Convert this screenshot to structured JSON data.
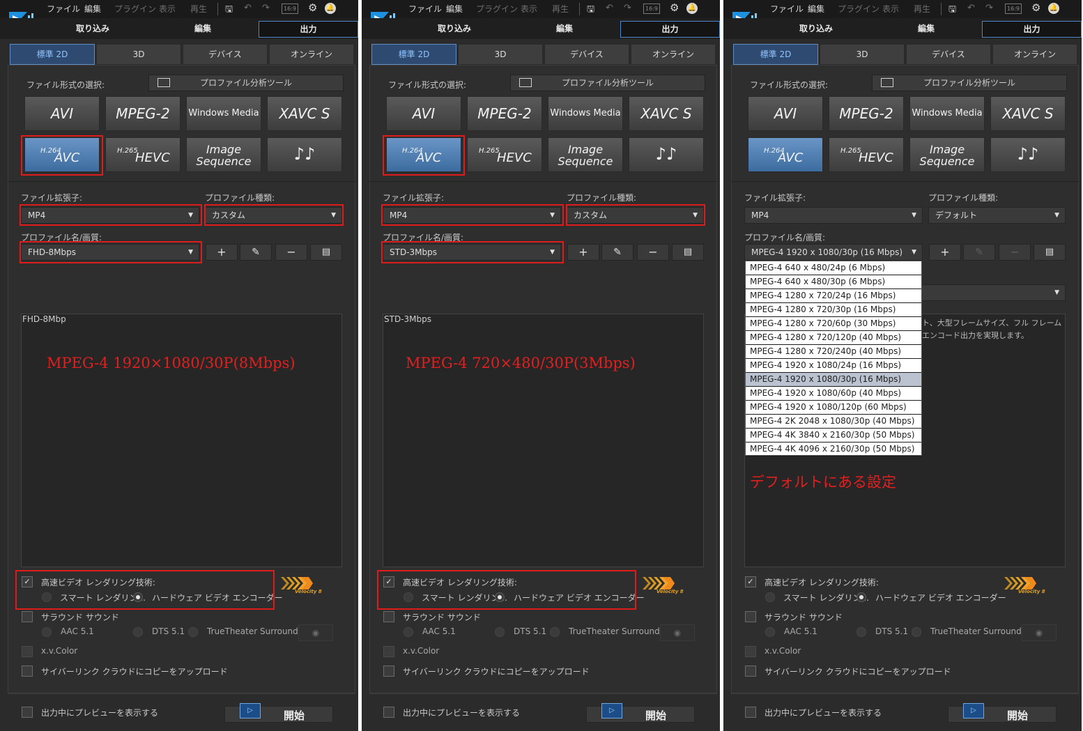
{
  "menu": {
    "file": "ファイル",
    "edit": "編集",
    "plugins": "プラグイン",
    "view": "表示",
    "playback": "再生"
  },
  "toolbar": {
    "aspect": "16:9"
  },
  "main_tabs": {
    "capture": "取り込み",
    "edit": "編集",
    "produce": "出力"
  },
  "sub_tabs": {
    "standard2d": "標準 2D",
    "threed": "3D",
    "device": "デバイス",
    "online": "オンライン"
  },
  "format_section": {
    "label": "ファイル形式の選択:",
    "analyzer": "プロファイル分析ツール"
  },
  "formats": {
    "avi": "AVI",
    "mpeg2": "MPEG-2",
    "wmv": "Windows Media",
    "xavc": "XAVC S",
    "h264_sup": "H.264",
    "avc": "AVC",
    "h265_sup": "H.265",
    "hevc": "HEVC",
    "image_seq_1": "Image",
    "image_seq_2": "Sequence",
    "audio": "♪♪"
  },
  "labels": {
    "extension": "ファイル拡張子:",
    "profile_type": "プロファイル種類:",
    "profile_name": "プロファイル名/画質:"
  },
  "buttons": {
    "add": "+",
    "edit": "✎",
    "remove": "−",
    "details": "▤"
  },
  "options": {
    "fast_render": "高速ビデオ レンダリング技術:",
    "smart_render": "スマート レンダリン...",
    "hw_encoder": "ハードウェア ビデオ エンコーダー",
    "surround": "サラウンド サウンド",
    "aac": "AAC 5.1",
    "dts": "DTS 5.1",
    "truetheater": "TrueTheater Surround",
    "xvcolor": "x.v.Color",
    "cyberlink_cloud": "サイバーリンク クラウドにコピーをアップロード",
    "preview": "出力中にプレビューを表示する",
    "start": "開始",
    "velocity": "Velocity 8"
  },
  "panel1": {
    "extension": "MP4",
    "profile_type": "カスタム",
    "profile_name": "FHD-8Mbps",
    "desc_title": "FHD-8Mbp",
    "annotation": "MPEG-4 1920×1080/30P(8Mbps)"
  },
  "panel2": {
    "extension": "MP4",
    "profile_type": "カスタム",
    "profile_name": "STD-3Mbps",
    "desc_title": "STD-3Mbps",
    "annotation": "MPEG-4 720×480/30P(3Mbps)"
  },
  "panel3": {
    "extension": "MP4",
    "profile_type": "デフォルト",
    "profile_name": "MPEG-4 1920 x 1080/30p (16 Mbps)",
    "desc_line1": "ト、大型フレームサイズ、フル フレーム",
    "desc_line2": "エンコード出力を実現します。",
    "annotation": "デフォルトにある設定",
    "dropdown": [
      "MPEG-4 640 x 480/24p (6 Mbps)",
      "MPEG-4 640 x 480/30p (6 Mbps)",
      "MPEG-4 1280 x 720/24p (16 Mbps)",
      "MPEG-4 1280 x 720/30p (16 Mbps)",
      "MPEG-4 1280 x 720/60p (30 Mbps)",
      "MPEG-4 1280 x 720/120p (40 Mbps)",
      "MPEG-4 1280 x 720/240p (40 Mbps)",
      "MPEG-4 1920 x 1080/24p (16 Mbps)",
      "MPEG-4 1920 x 1080/30p (16 Mbps)",
      "MPEG-4 1920 x 1080/60p (40 Mbps)",
      "MPEG-4 1920 x 1080/120p (60 Mbps)",
      "MPEG-4 2K 2048 x 1080/30p (40 Mbps)",
      "MPEG-4 4K 3840 x 2160/30p (50 Mbps)",
      "MPEG-4 4K 4096 x 2160/30p (50 Mbps)"
    ],
    "dropdown_selected": "MPEG-4 1920 x 1080/30p (16 Mbps)"
  }
}
